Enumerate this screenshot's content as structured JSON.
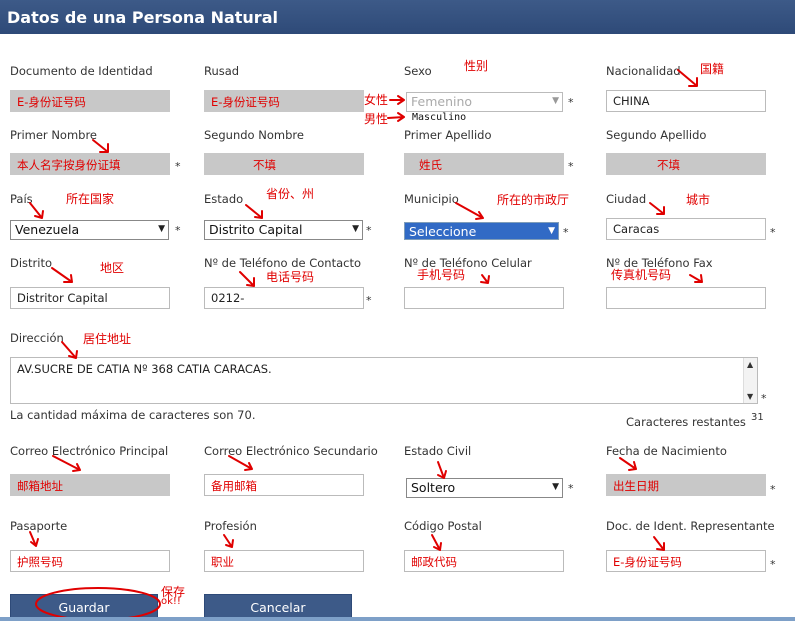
{
  "title": "Datos de una Persona Natural",
  "labels": {
    "documento": "Documento de Identidad",
    "rusad": "Rusad",
    "sexo": "Sexo",
    "nacionalidad": "Nacionalidad",
    "primer_nombre": "Primer Nombre",
    "segundo_nombre": "Segundo Nombre",
    "primer_apellido": "Primer Apellido",
    "segundo_apellido": "Segundo Apellido",
    "pais": "País",
    "estado": "Estado",
    "municipio": "Municipio",
    "ciudad": "Ciudad",
    "distrito": "Distrito",
    "tel_contacto": "Nº de Teléfono de Contacto",
    "tel_celular": "Nº de Teléfono Celular",
    "tel_fax": "Nº de Teléfono Fax",
    "direccion": "Dirección",
    "max_chars": "La cantidad máxima de caracteres son 70.",
    "remaining": "Caracteres restantes",
    "remaining_count": "31",
    "correo_principal": "Correo Electrónico Principal",
    "correo_secundario": "Correo Electrónico Secundario",
    "estado_civil": "Estado Civil",
    "fecha_nacimiento": "Fecha de Nacimiento",
    "pasaporte": "Pasaporte",
    "profesion": "Profesión",
    "codigo_postal": "Código Postal",
    "doc_representante": "Doc. de Ident. Representante"
  },
  "values": {
    "documento": "E-身份证号码",
    "rusad": "E-身份证号码",
    "sexo": "Femenino",
    "sexo_option": "Masculino",
    "nacionalidad": "CHINA",
    "primer_nombre": "本人名字按身份证填",
    "segundo_nombre": "不填",
    "primer_apellido": "姓氏",
    "segundo_apellido": "不填",
    "pais": "Venezuela",
    "estado": "Distrito Capital",
    "municipio": "Seleccione",
    "ciudad": "Caracas",
    "distrito": "Distritor Capital",
    "tel_contacto": "0212-",
    "tel_celular": "",
    "tel_fax": "",
    "direccion": "AV.SUCRE DE CATIA Nº 368 CATIA CARACAS.",
    "correo_principal": "邮箱地址",
    "correo_secundario": "备用邮箱",
    "estado_civil": "Soltero",
    "fecha_nacimiento": "出生日期",
    "pasaporte": "护照号码",
    "profesion": "职业",
    "codigo_postal": "邮政代码",
    "doc_representante": "E-身份证号码"
  },
  "annotations": {
    "sexo": "性别",
    "nacionalidad": "国籍",
    "female": "女性",
    "male": "男性",
    "pais": "所在国家",
    "estado": "省份、州",
    "municipio": "所在的市政厅",
    "ciudad": "城市",
    "distrito": "地区",
    "tel_contacto": "电话号码",
    "tel_celular": "手机号码",
    "tel_fax": "传真机号码",
    "direccion": "居住地址",
    "save": "保存",
    "ok": "ok!!"
  },
  "buttons": {
    "guardar": "Guardar",
    "cancelar": "Cancelar"
  },
  "required_mark": "*",
  "colors": {
    "header": "#3d5a88",
    "annotation": "#e00000",
    "readonly_field": "#c8c8c8",
    "selected_option": "#316ac5"
  }
}
